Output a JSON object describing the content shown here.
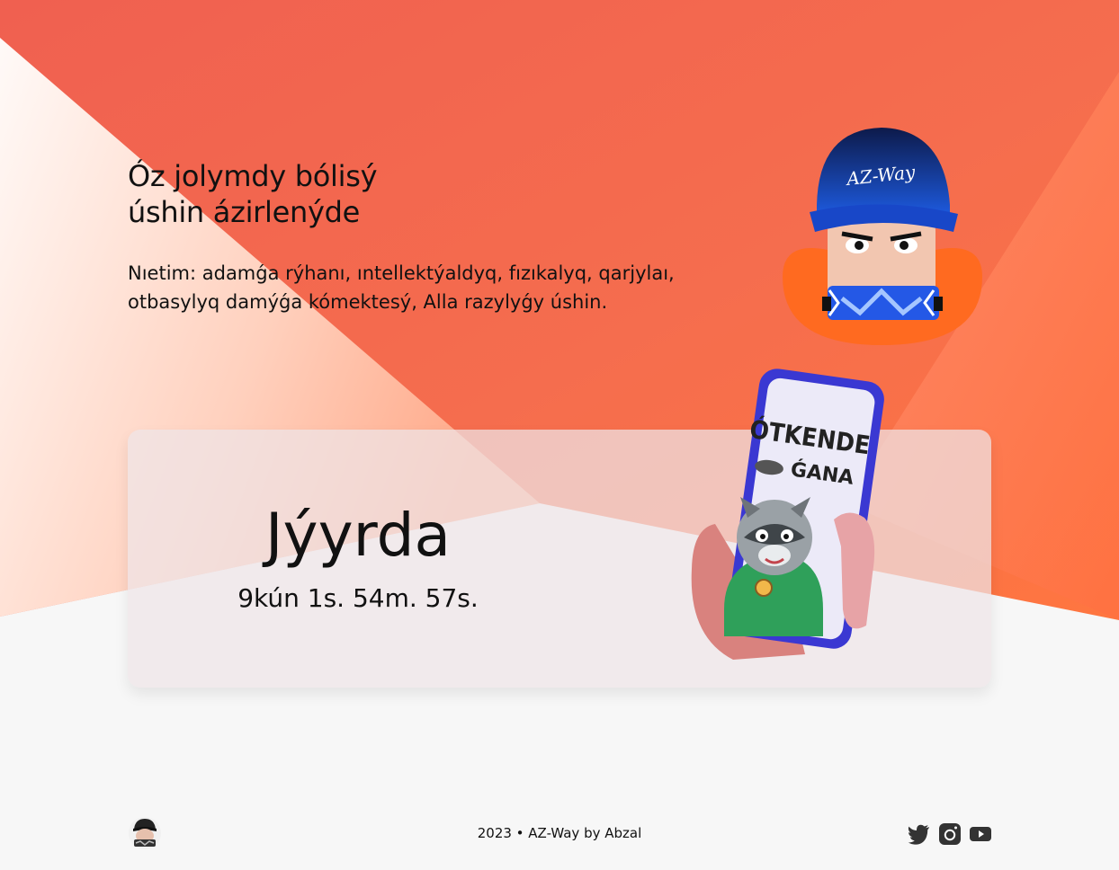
{
  "hero": {
    "title_line1": "Óz jolymdy bólisý",
    "title_line2": "úshin ázirlenýde",
    "mission": "Nıetim: adamǵa rýhanı, ıntellektýaldyq, fızıkalyq, qarjylaı, otbasylyq damýǵa kómektesý, Alla razylyǵy úshin."
  },
  "mascot": {
    "cap_text": "AZ-Way",
    "icon": "mascot-avatar"
  },
  "countdown": {
    "title": "Jýyrda",
    "value": "9kún 1s. 54m. 57s."
  },
  "phone": {
    "headline": "ÓTKENDE",
    "subline": "ǴANA"
  },
  "footer": {
    "text": "2023 • AZ-Way by Abzal",
    "social": [
      "twitter-icon",
      "instagram-icon",
      "youtube-icon"
    ]
  },
  "colors": {
    "accent_orange": "#F46A4E",
    "accent_orange_light": "#FF7F50",
    "card_tint": "#EEE4E8",
    "background": "#F7F7F7",
    "text": "#111111",
    "phone_frame": "#3A38D2"
  }
}
